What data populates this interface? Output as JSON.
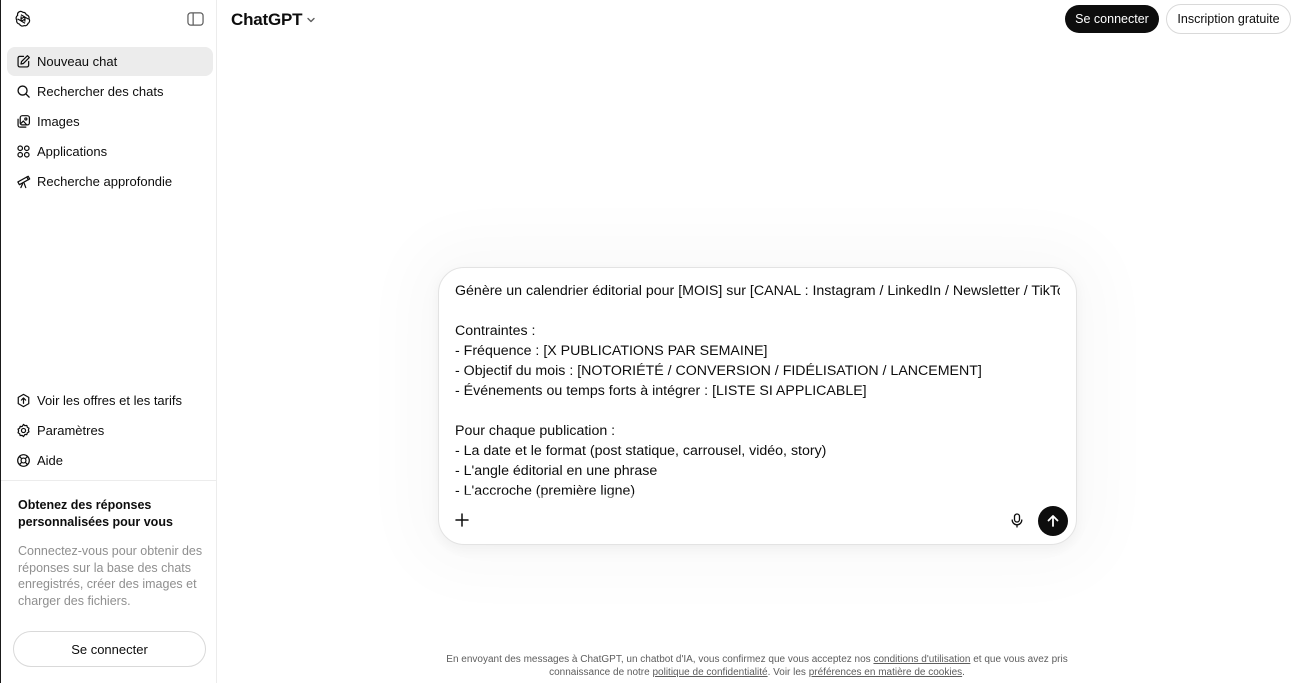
{
  "sidebar": {
    "nav": [
      {
        "label": "Nouveau chat",
        "icon": "edit-icon"
      },
      {
        "label": "Rechercher des chats",
        "icon": "search-icon"
      },
      {
        "label": "Images",
        "icon": "images-icon"
      },
      {
        "label": "Applications",
        "icon": "apps-grid-icon"
      },
      {
        "label": "Recherche approfondie",
        "icon": "telescope-icon"
      }
    ],
    "bottom": [
      {
        "label": "Voir les offres et les tarifs",
        "icon": "upgrade-icon"
      },
      {
        "label": "Paramètres",
        "icon": "gear-icon"
      },
      {
        "label": "Aide",
        "icon": "help-icon"
      }
    ],
    "promo_title": "Obtenez des réponses personnalisées pour vous",
    "promo_text": "Connectez-vous pour obtenir des réponses sur la base des chats enregistrés, créer des images et charger des fichiers.",
    "login_label": "Se connecter"
  },
  "header": {
    "model": "ChatGPT",
    "login_label": "Se connecter",
    "signup_label": "Inscription gratuite"
  },
  "composer": {
    "prompt": "Génère un calendrier éditorial pour [MOIS] sur [CANAL : Instagram / LinkedIn / Newsletter / TikTok].\n\nContraintes :\n- Fréquence : [X PUBLICATIONS PAR SEMAINE]\n- Objectif du mois : [NOTORIÉTÉ / CONVERSION / FIDÉLISATION / LANCEMENT]\n- Événements ou temps forts à intégrer : [LISTE SI APPLICABLE]\n\nPour chaque publication :\n- La date et le format (post statique, carrousel, vidéo, story)\n- L'angle éditorial en une phrase\n- L'accroche (première ligne)"
  },
  "footer": {
    "text1": "En envoyant des messages à ChatGPT, un chatbot d'IA, vous confirmez que vous acceptez nos ",
    "link_terms": "conditions d'utilisation",
    "text2": " et que vous avez pris connaissance de notre ",
    "link_privacy": "politique de confidentialité",
    "text3": ". Voir les ",
    "link_cookies": "préférences en matière de cookies",
    "text4": "."
  }
}
